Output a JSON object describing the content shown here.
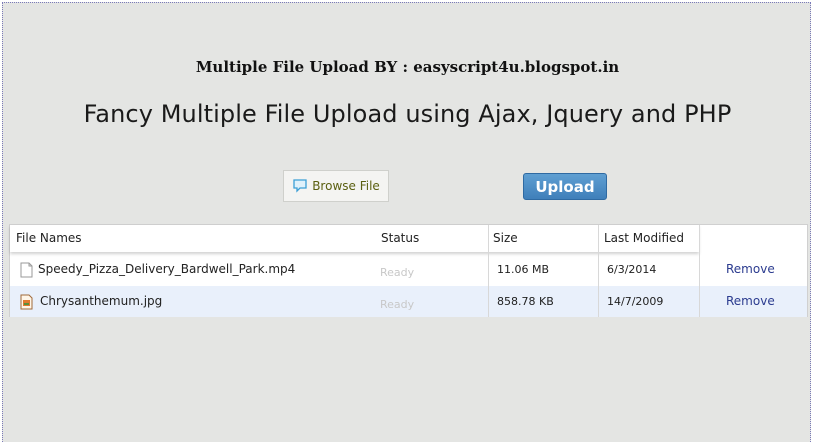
{
  "header": {
    "credit": "Multiple File Upload BY : easyscript4u.blogspot.in",
    "title": "Fancy Multiple File Upload using Ajax, Jquery and PHP"
  },
  "controls": {
    "browse_label": "Browse File",
    "upload_label": "Upload"
  },
  "colors": {
    "upload_button": "#4a8ac4",
    "remove_link": "#2b3b8f",
    "alt_row": "#e9f0fb"
  },
  "table": {
    "columns": [
      "File Names",
      "Status",
      "Size",
      "Last Modified"
    ],
    "rows": [
      {
        "icon": "document-icon",
        "name": "Speedy_Pizza_Delivery_Bardwell_Park.mp4",
        "status": "Ready",
        "size": "11.06 MB",
        "modified": "6/3/2014",
        "action": "Remove"
      },
      {
        "icon": "image-file-icon",
        "name": "Chrysanthemum.jpg",
        "status": "Ready",
        "size": "858.78 KB",
        "modified": "14/7/2009",
        "action": "Remove"
      }
    ]
  }
}
